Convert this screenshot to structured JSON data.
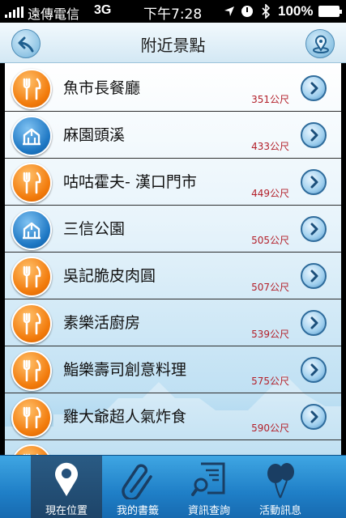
{
  "status_bar": {
    "carrier": "遠傳電信",
    "network": "3G",
    "time": "下午7:28",
    "battery": "100%"
  },
  "navbar": {
    "title": "附近景點"
  },
  "places": [
    {
      "name": "魚市長餐廳",
      "distance": "351公尺",
      "category": "food"
    },
    {
      "name": "麻園頭溪",
      "distance": "433公尺",
      "category": "park"
    },
    {
      "name": "咕咕霍夫- 漢口門市",
      "distance": "449公尺",
      "category": "food"
    },
    {
      "name": "三信公園",
      "distance": "505公尺",
      "category": "park"
    },
    {
      "name": "吳記脆皮肉圓",
      "distance": "507公尺",
      "category": "food"
    },
    {
      "name": "素樂活廚房",
      "distance": "539公尺",
      "category": "food"
    },
    {
      "name": "鮨樂壽司創意料理",
      "distance": "575公尺",
      "category": "food"
    },
    {
      "name": "雞大爺超人氣炸食",
      "distance": "590公尺",
      "category": "food"
    }
  ],
  "tabs": [
    {
      "label": "現在位置",
      "icon": "location-pin-icon",
      "active": true
    },
    {
      "label": "我的書籤",
      "icon": "paperclip-icon",
      "active": false
    },
    {
      "label": "資訊查詢",
      "icon": "search-document-icon",
      "active": false
    },
    {
      "label": "活動訊息",
      "icon": "balloons-icon",
      "active": false
    }
  ],
  "colors": {
    "food_badge": "#f27b0c",
    "park_badge": "#1f78c4",
    "distance_text": "#b3202a",
    "tabbar": "#1f7fc7"
  }
}
